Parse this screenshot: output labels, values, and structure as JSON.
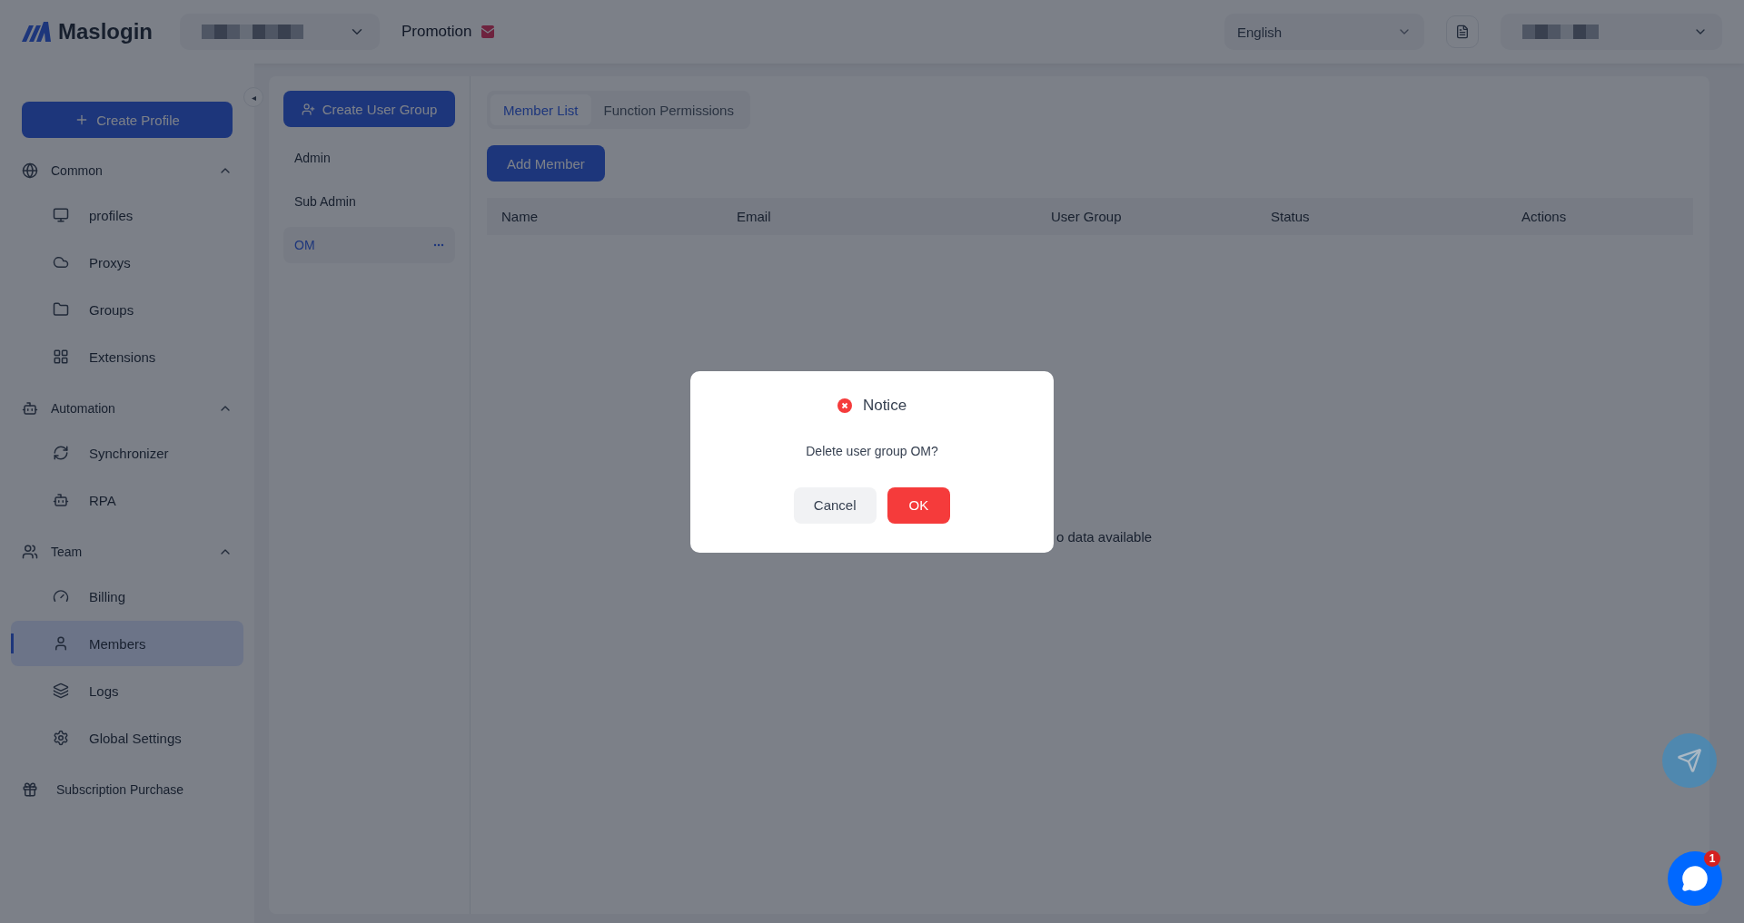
{
  "header": {
    "logo": "Maslogin",
    "promotion": "Promotion",
    "language": "English"
  },
  "sidebar": {
    "create_button": "Create Profile",
    "collapse_button": "◂",
    "sections": [
      {
        "title": "Common",
        "expanded": true,
        "items": [
          {
            "label": "profiles",
            "selected": false
          },
          {
            "label": "Proxys",
            "selected": false
          },
          {
            "label": "Groups",
            "selected": false
          },
          {
            "label": "Extensions",
            "selected": false
          }
        ]
      },
      {
        "title": "Automation",
        "expanded": true,
        "items": [
          {
            "label": "Synchronizer",
            "selected": false
          },
          {
            "label": "RPA",
            "selected": false
          }
        ]
      },
      {
        "title": "Team",
        "expanded": true,
        "items": [
          {
            "label": "Billing",
            "selected": false
          },
          {
            "label": "Members",
            "selected": true
          },
          {
            "label": "Logs",
            "selected": false
          },
          {
            "label": "Global Settings",
            "selected": false
          }
        ]
      }
    ],
    "footer_item": "Subscription Purchase"
  },
  "user_groups": {
    "create_button": "Create User Group",
    "groups": [
      {
        "name": "Admin",
        "selected": false
      },
      {
        "name": "Sub Admin",
        "selected": false
      },
      {
        "name": "OM",
        "selected": true
      }
    ]
  },
  "tabs": [
    {
      "label": "Member List",
      "selected": true
    },
    {
      "label": "Function Permissions",
      "selected": false
    }
  ],
  "add_button": "Add Member",
  "table": {
    "columns": [
      "Name",
      "Email",
      "User Group",
      "Status",
      "Actions"
    ],
    "empty_text": "o data available"
  },
  "dialog": {
    "title": "Notice",
    "message": "Delete user group OM?",
    "buttons": [
      {
        "label": "Cancel",
        "kind": "secondary"
      },
      {
        "label": "OK",
        "kind": "danger"
      }
    ]
  },
  "chat": {
    "badge": "1"
  }
}
